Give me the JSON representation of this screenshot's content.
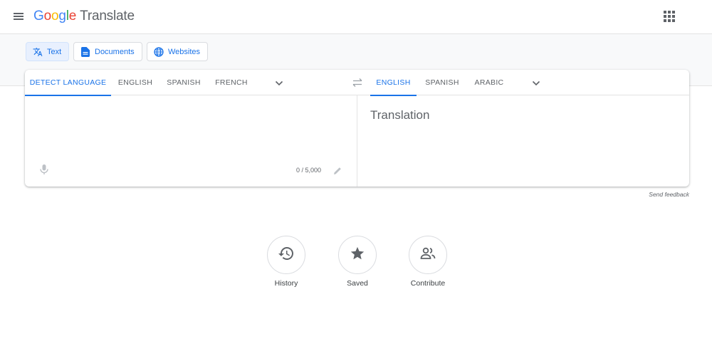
{
  "header": {
    "logo_google_letters": [
      "G",
      "o",
      "o",
      "g",
      "l",
      "e"
    ],
    "logo_product": "Translate"
  },
  "modes": [
    {
      "label": "Text",
      "icon": "translate-icon",
      "active": true
    },
    {
      "label": "Documents",
      "icon": "document-icon",
      "active": false
    },
    {
      "label": "Websites",
      "icon": "globe-icon",
      "active": false
    }
  ],
  "source": {
    "tabs": [
      "DETECT LANGUAGE",
      "ENGLISH",
      "SPANISH",
      "FRENCH"
    ],
    "active_tab": "DETECT LANGUAGE",
    "text": "",
    "char_count": "0 / 5,000"
  },
  "target": {
    "tabs": [
      "ENGLISH",
      "SPANISH",
      "ARABIC"
    ],
    "active_tab": "ENGLISH",
    "placeholder": "Translation"
  },
  "feedback_label": "Send feedback",
  "actions": [
    {
      "label": "History",
      "icon": "history-icon"
    },
    {
      "label": "Saved",
      "icon": "star-icon"
    },
    {
      "label": "Contribute",
      "icon": "people-icon"
    }
  ],
  "colors": {
    "accent": "#1a73e8",
    "text": "#3c4043",
    "muted": "#5f6368",
    "band": "#f8f9fa",
    "active_tab_bg": "#e8f0fe"
  }
}
